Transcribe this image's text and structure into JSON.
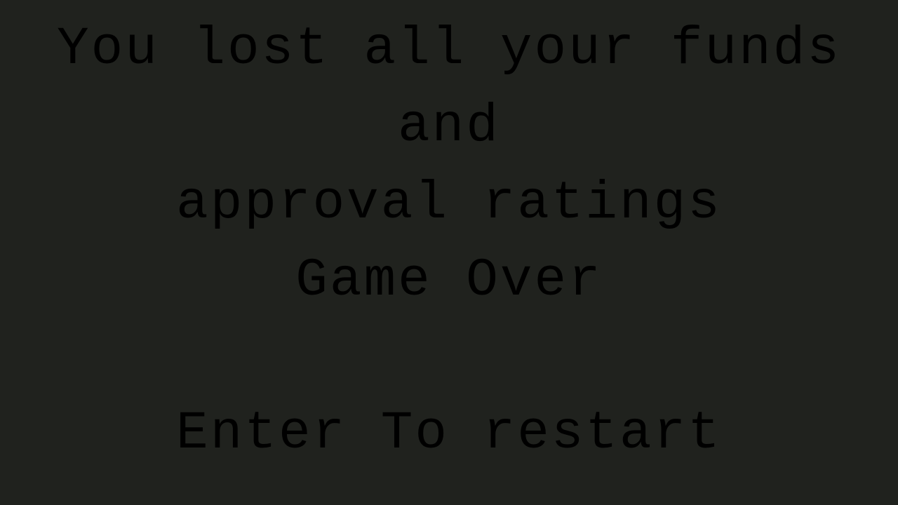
{
  "game_over_screen": {
    "message_lines": [
      "You lost all your funds",
      "and",
      "approval ratings",
      "Game Over"
    ],
    "restart_prompt": "Enter To restart"
  },
  "colors": {
    "background": "#20221e",
    "text": "#000000"
  }
}
